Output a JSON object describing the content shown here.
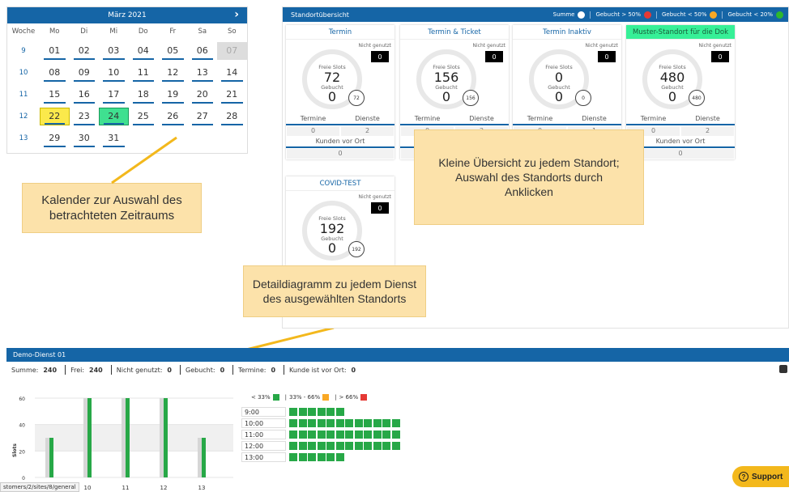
{
  "calendar": {
    "month": "März 2021",
    "next_icon": "›",
    "headers": [
      "Woche",
      "Mo",
      "Di",
      "Mi",
      "Do",
      "Fr",
      "Sa",
      "So"
    ],
    "weeks": [
      {
        "wk": "9",
        "days": [
          "01",
          "02",
          "03",
          "04",
          "05",
          "06",
          "07"
        ]
      },
      {
        "wk": "10",
        "days": [
          "08",
          "09",
          "10",
          "11",
          "12",
          "13",
          "14"
        ]
      },
      {
        "wk": "11",
        "days": [
          "15",
          "16",
          "17",
          "18",
          "19",
          "20",
          "21"
        ]
      },
      {
        "wk": "12",
        "days": [
          "22",
          "23",
          "24",
          "25",
          "26",
          "27",
          "28"
        ]
      },
      {
        "wk": "13",
        "days": [
          "29",
          "30",
          "31",
          "",
          "",
          "",
          ""
        ]
      }
    ]
  },
  "callouts": {
    "calendar": "Kalender zur Auswahl des betrachteten Zeitraums",
    "overview": "Kleine Übersicht zu jedem Standort; Auswahl des Standorts durch Anklicken",
    "detail": "Detaildiagramm zu jedem Dienst des ausgewählten Standorts"
  },
  "standort": {
    "title": "Standortübersicht",
    "legend": [
      {
        "label": "Summe",
        "color": "#ffffff"
      },
      {
        "label": "Gebucht > 50%",
        "color": "#e53935"
      },
      {
        "label": "Gebucht < 50%",
        "color": "#f9a825"
      },
      {
        "label": "Gebucht < 20%",
        "color": "#2eb82e"
      }
    ],
    "labels": {
      "free": "Freie Slots",
      "booked": "Gebucht",
      "unused": "Nicht genutzt",
      "termine": "Termine",
      "dienste": "Dienste",
      "kunden": "Kunden vor Ort"
    },
    "cards": [
      {
        "name": "Termin",
        "free": "72",
        "booked": "0",
        "sum": "72",
        "unused": "0",
        "termine": "0",
        "dienste": "2",
        "kunden": "0"
      },
      {
        "name": "Termin & Ticket",
        "free": "156",
        "booked": "0",
        "sum": "156",
        "unused": "0",
        "termine": "0",
        "dienste": "2",
        "kunden": "0"
      },
      {
        "name": "Termin Inaktiv",
        "free": "0",
        "booked": "0",
        "sum": "0",
        "unused": "0",
        "termine": "0",
        "dienste": "1",
        "kunden": "0"
      },
      {
        "name": "Muster-Standort für die Dok",
        "free": "480",
        "booked": "0",
        "sum": "480",
        "unused": "0",
        "termine": "0",
        "dienste": "2",
        "kunden": "0"
      },
      {
        "name": "COVID-TEST",
        "free": "192",
        "booked": "0",
        "sum": "192",
        "unused": "0"
      }
    ]
  },
  "dienst": {
    "title": "Demo-Dienst 01",
    "stats": [
      {
        "label": "Summe:",
        "value": "240"
      },
      {
        "label": "Frei:",
        "value": "240"
      },
      {
        "label": "Nicht genutzt:",
        "value": "0"
      },
      {
        "label": "Gebucht:",
        "value": "0"
      },
      {
        "label": "Termine:",
        "value": "0"
      },
      {
        "label": "Kunde ist vor Ort:",
        "value": "0"
      }
    ],
    "grid_legend": [
      {
        "label": "< 33%",
        "color": "#27a847"
      },
      {
        "label": "33% - 66%",
        "color": "#f9a825"
      },
      {
        "label": "> 66%",
        "color": "#e53935"
      }
    ],
    "times": [
      {
        "t": "9:00",
        "n": 6
      },
      {
        "t": "10:00",
        "n": 12
      },
      {
        "t": "11:00",
        "n": 12
      },
      {
        "t": "12:00",
        "n": 12
      },
      {
        "t": "13:00",
        "n": 6
      }
    ]
  },
  "chart_data": {
    "type": "bar",
    "ylabel": "Slots",
    "categories": [
      "9",
      "10",
      "11",
      "12",
      "13"
    ],
    "series": [
      {
        "values": [
          30,
          60,
          60,
          60,
          30
        ]
      },
      {
        "values": [
          30,
          60,
          60,
          60,
          30
        ]
      }
    ],
    "ylim": [
      0,
      60
    ],
    "yticks": [
      0,
      20,
      40,
      60
    ]
  },
  "url_hint": "stomers/2/sites/8/general",
  "support_label": "Support"
}
